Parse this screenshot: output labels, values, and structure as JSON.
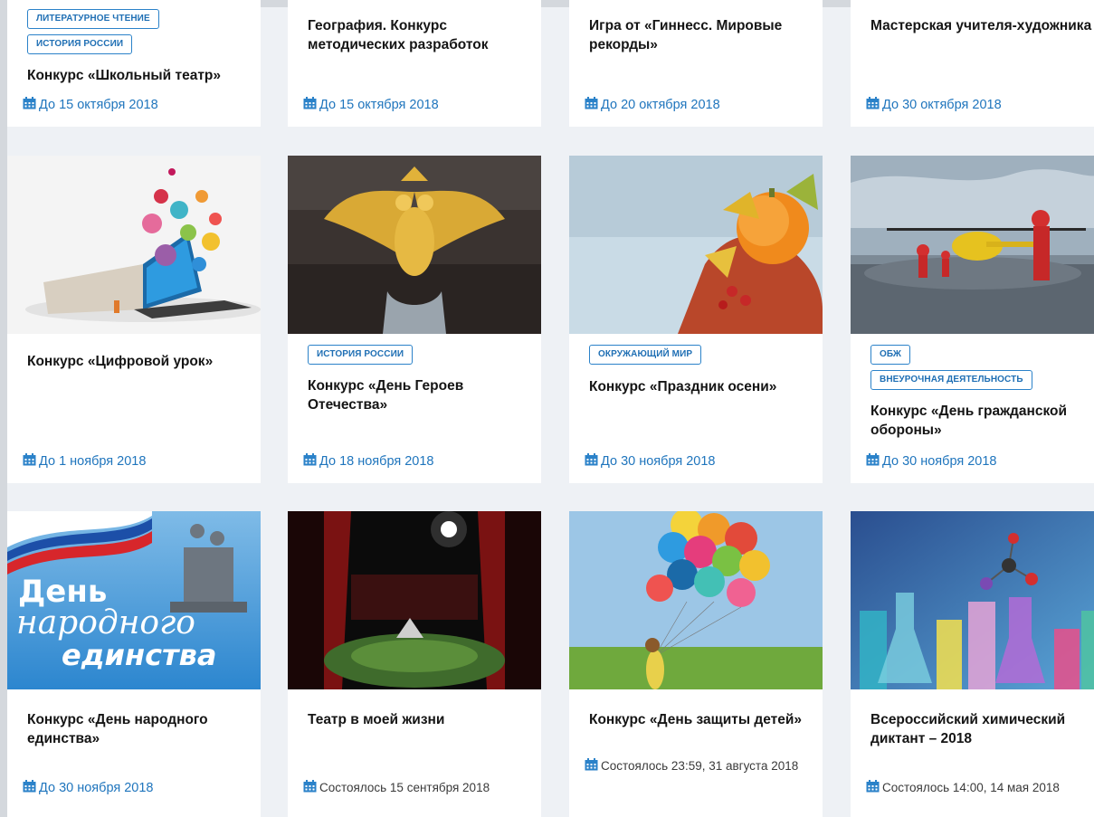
{
  "cards": [
    {
      "tags": [
        "ЛИТЕРАТУРНОЕ ЧТЕНИЕ",
        "ИСТОРИЯ РОССИИ"
      ],
      "title": "Конкурс «Школьный театр»",
      "date": "До 15 октября 2018"
    },
    {
      "title": "География. Конкурс методических разработок",
      "date": "До 15 октября 2018"
    },
    {
      "title": "Игра от «Гиннесс. Мировые рекорды»",
      "date": "До 20 октября 2018"
    },
    {
      "title": "Мастерская учителя-художника",
      "date": "До 30 октября 2018"
    },
    {
      "title": "Конкурс «Цифровой урок»",
      "date": "До 1 ноября 2018"
    },
    {
      "tags": [
        "ИСТОРИЯ РОССИИ"
      ],
      "title": "Конкурс «День Героев Отечества»",
      "date": "До 18 ноября 2018"
    },
    {
      "tags": [
        "ОКРУЖАЮЩИЙ МИР"
      ],
      "title": "Конкурс «Праздник осени»",
      "date": "До 30 ноября 2018"
    },
    {
      "tags": [
        "ОБЖ",
        "ВНЕУРОЧНАЯ ДЕЯТЕЛЬНОСТЬ"
      ],
      "title": "Конкурс «День гражданской обороны»",
      "date": "До 30 ноября 2018"
    },
    {
      "title": "Конкурс «День народного единства»",
      "date": "До 30 ноября 2018",
      "image_text": [
        "День",
        "народного",
        "единства"
      ]
    },
    {
      "title": "Театр в моей жизни",
      "date": "Состоялось 15 сентября 2018"
    },
    {
      "title": "Конкурс «День защиты детей»",
      "date": "Состоялось 23:59, 31 августа 2018"
    },
    {
      "title": "Всероссийский химический диктант – 2018",
      "date": "Состоялось 14:00, 14 мая 2018"
    }
  ],
  "icons": {
    "date": "calendar-icon"
  },
  "colors": {
    "accent": "#1f75bd",
    "tag_border": "#2b82c9",
    "background": "#eef1f5"
  }
}
